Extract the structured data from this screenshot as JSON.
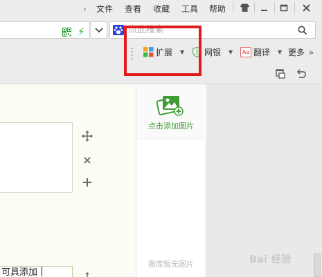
{
  "menubar": {
    "items": [
      "文件",
      "查看",
      "收藏",
      "工具",
      "帮助"
    ]
  },
  "addressbar": {
    "search_placeholder": "点此搜索"
  },
  "toolbar": {
    "extensions_label": "扩展",
    "netbank_label": "网银",
    "translate_label": "翻译",
    "more_label": "更多",
    "translate_icon_text": "Aa"
  },
  "image_panel": {
    "add_label": "点击添加图片",
    "empty_label": "图库暂无图片"
  },
  "editor": {
    "textbox_partial_text": "可具添加"
  },
  "watermark": {
    "text": "Bai  经验"
  },
  "colors": {
    "highlight": "#e11b1b",
    "accent_green": "#3f9c35",
    "baidu_blue": "#2c3fd6"
  }
}
